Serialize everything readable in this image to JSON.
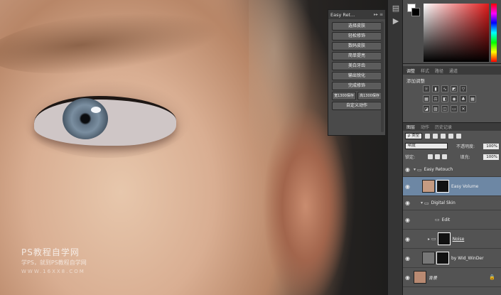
{
  "canvas": {
    "watermark_line1": "PS教程自学网",
    "watermark_line2": "学PS，就到PS教程自学网",
    "watermark_line3": "WWW.16XX8.COM"
  },
  "actions_panel": {
    "title": "Easy Ret...",
    "controls": "▸▸ ≡",
    "buttons": [
      "选择皮肤",
      "轻松修饰",
      "数码皮肤",
      "简单提亮",
      "美白牙齿",
      "输出锐化",
      "完成修饰"
    ],
    "row_buttons": [
      "宽1300保存",
      "高1300保存"
    ],
    "last_button": "自定义动作"
  },
  "adjustments": {
    "tabs": [
      "调整",
      "样式",
      "路径",
      "通道"
    ],
    "title": "添加调整",
    "icon_names": [
      "brightness-icon",
      "levels-icon",
      "curves-icon",
      "exposure-icon",
      "vibrance-icon",
      "hue-icon",
      "color-balance-icon",
      "bw-icon",
      "photo-filter-icon",
      "channel-mixer-icon",
      "lookup-icon",
      "invert-icon",
      "posterize-icon",
      "threshold-icon",
      "gradient-map-icon",
      "selective-color-icon"
    ]
  },
  "layers_panel": {
    "tabs": [
      "图层",
      "动作",
      "历史记录"
    ],
    "kind_select": "ρ 类型",
    "blend_mode": "明度",
    "opacity_label": "不透明度:",
    "opacity_value": "100%",
    "lock_label": "锁定:",
    "fill_label": "填充:",
    "fill_value": "100%",
    "layers": [
      {
        "name": "Easy Retouch"
      },
      {
        "name": "Easy Volume"
      },
      {
        "name": "Digital Skin"
      },
      {
        "name": "Edit"
      },
      {
        "name": "Noise"
      },
      {
        "name": "by Wid_WinDer"
      },
      {
        "name": "背景"
      }
    ]
  },
  "colors": {
    "panel_bg": "#535353",
    "selected_layer": "#6d87a4",
    "foreground": "#ffffff",
    "background": "#000000"
  }
}
